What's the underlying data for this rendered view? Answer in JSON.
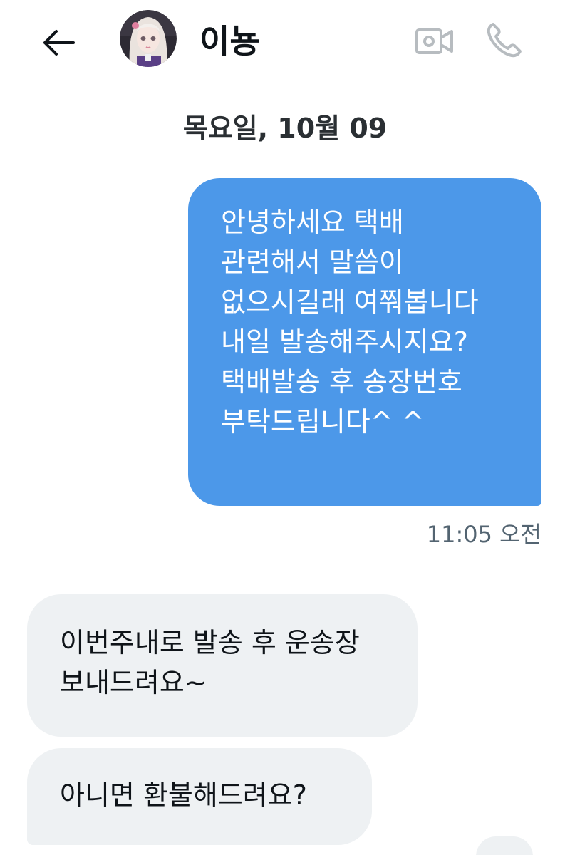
{
  "header": {
    "back_icon": "arrow-left-icon",
    "contact_name": "이뇽",
    "avatar_icon": "avatar-doll-photo",
    "video_icon": "video-camera-icon",
    "call_icon": "phone-icon",
    "icon_color": "#b7bcc0"
  },
  "conversation": {
    "date_separator": "목요일, 10월 09",
    "messages": [
      {
        "direction": "sent",
        "text": "안녕하세요 택배\n관련해서 말씀이\n없으시길래 여쭤봅니다\n내일  발송해주시지요?\n택배발송 후 송장번호\n부탁드립니다^ ^",
        "time": "11:05 오전",
        "color": "#4c98e9"
      },
      {
        "direction": "received",
        "text": "이번주내로 발송 후 운송장\n보내드려요~",
        "color": "#eef1f3"
      },
      {
        "direction": "received",
        "text": "아니면 환불해드려요?",
        "color": "#eef1f3"
      }
    ]
  }
}
